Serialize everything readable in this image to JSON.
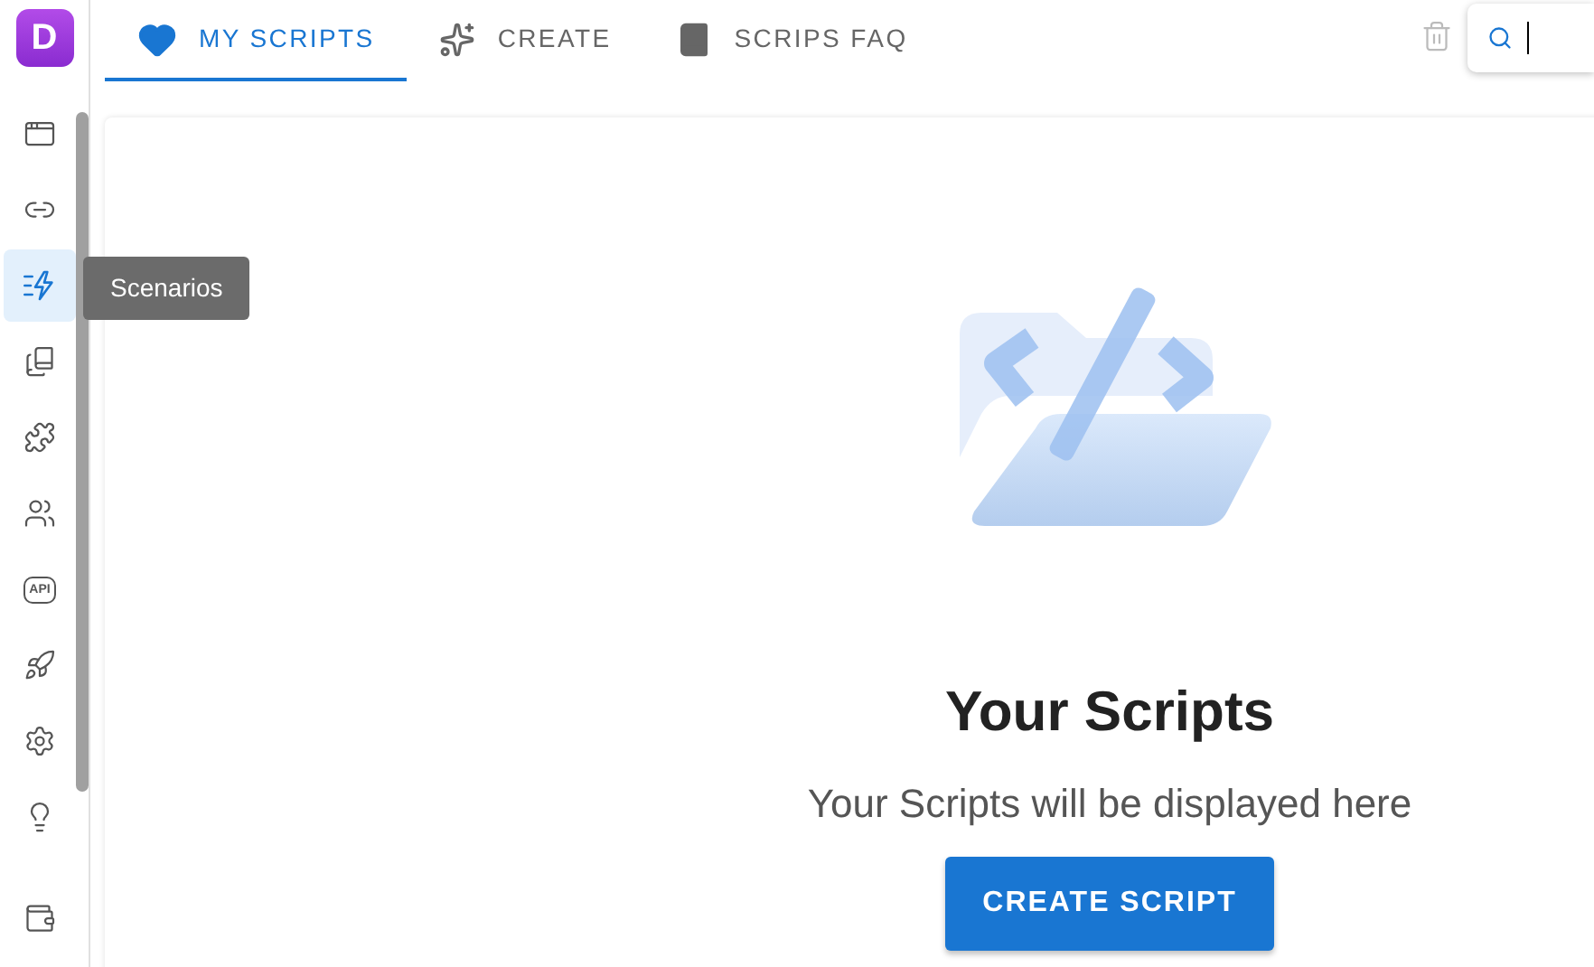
{
  "logo": {
    "letter": "D"
  },
  "sidebar": {
    "items": [
      {
        "kind": "window",
        "selected": false
      },
      {
        "kind": "link",
        "selected": false
      },
      {
        "kind": "scenarios",
        "selected": true,
        "tooltip": "Scenarios"
      },
      {
        "kind": "bookmarks",
        "selected": false
      },
      {
        "kind": "puzzle",
        "selected": false
      },
      {
        "kind": "users",
        "selected": false
      },
      {
        "kind": "api",
        "selected": false,
        "badge": "API"
      },
      {
        "kind": "rocket",
        "selected": false
      },
      {
        "kind": "settings",
        "selected": false
      },
      {
        "kind": "bulb",
        "selected": false
      },
      {
        "kind": "wallet",
        "selected": false
      }
    ]
  },
  "tabs": [
    {
      "kind": "heart",
      "label": "MY SCRIPTS",
      "selected": true
    },
    {
      "kind": "sparkles",
      "label": "CREATE",
      "selected": false
    },
    {
      "kind": "book",
      "label": "SCRIPS FAQ",
      "selected": false
    }
  ],
  "empty_state": {
    "title": "Your Scripts",
    "subtitle": "Your Scripts will be displayed here",
    "button": "CREATE SCRIPT"
  }
}
